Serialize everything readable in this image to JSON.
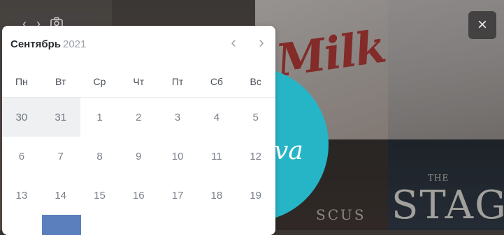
{
  "calendar": {
    "month": "Сентябрь",
    "year": "2021",
    "weekdays": [
      "Пн",
      "Вт",
      "Ср",
      "Чт",
      "Пт",
      "Сб",
      "Вс"
    ],
    "weeks": [
      [
        "30",
        "31",
        "1",
        "2",
        "3",
        "4",
        "5"
      ],
      [
        "6",
        "7",
        "8",
        "9",
        "10",
        "11",
        "12"
      ],
      [
        "13",
        "14",
        "15",
        "16",
        "17",
        "18",
        "19"
      ]
    ]
  },
  "background": {
    "milk_text": "Milk",
    "teal_text": "va",
    "the_text": "THE",
    "stag_text": "STAG",
    "scus_text": "SCUS",
    "accent_teal": "#26b5c6",
    "selected_blue": "#5b7fbd"
  },
  "icons": {
    "prev": "‹",
    "next": "›",
    "camera": "camera-icon",
    "close": "×"
  }
}
